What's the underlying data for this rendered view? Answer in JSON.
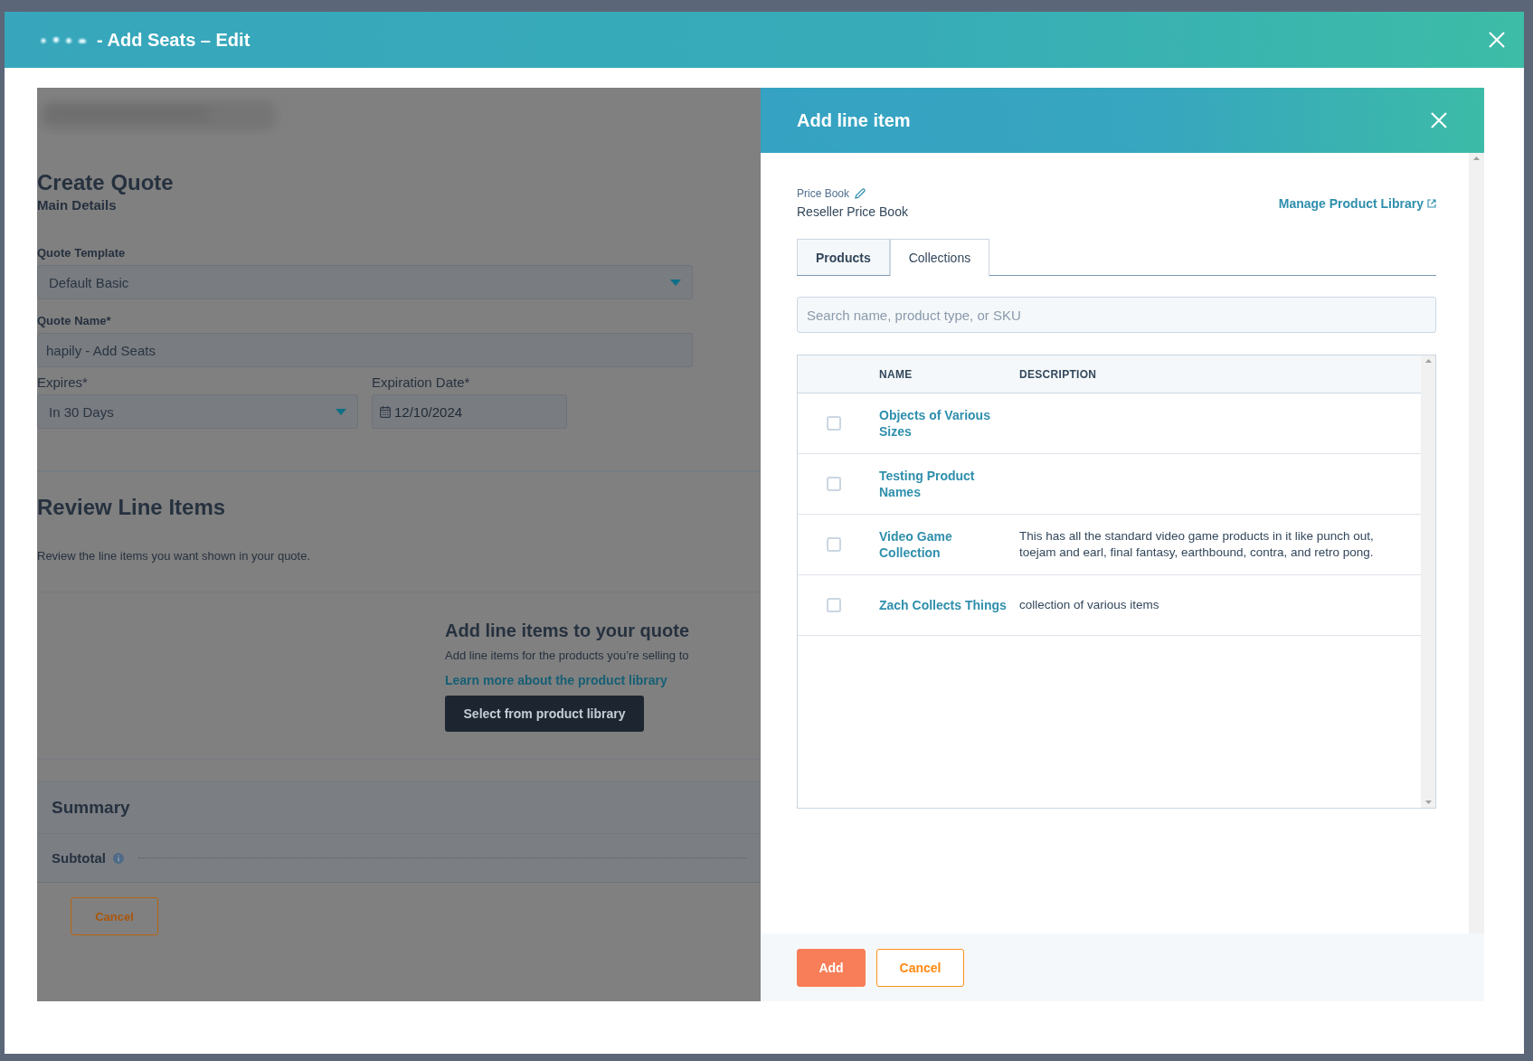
{
  "dialog": {
    "title": "- Add Seats – Edit"
  },
  "quote_form": {
    "heading": "Create Quote",
    "subheading": "Main Details",
    "fields": [
      {
        "kind": "select",
        "label": "Quote Template",
        "value": "Default Basic"
      },
      {
        "kind": "text",
        "label": "Quote Name*",
        "value": "hapily - Add Seats"
      },
      {
        "kind": "select",
        "label": "Expires*",
        "value": "In 30 Days"
      },
      {
        "kind": "date",
        "label": "Expiration Date*",
        "value": "12/10/2024"
      }
    ]
  },
  "line_items": {
    "heading": "Review Line Items",
    "description": "Review the line items you want shown in your quote.",
    "empty_heading": "Add line items to your quote",
    "empty_text": "Add line items for the products you’re selling to",
    "link": "Learn more about the product library",
    "button": "Select from product library"
  },
  "summary": {
    "heading": "Summary",
    "subtotal_label": "Subtotal"
  },
  "form_buttons": [
    "Cancel"
  ],
  "panel": {
    "title": "Add line item",
    "price_book_label": "Price Book",
    "price_book": "Reseller Price Book",
    "manage_link": "Manage Product Library",
    "tabs": [
      {
        "label": "Products",
        "selected": false
      },
      {
        "label": "Collections",
        "selected": true
      }
    ],
    "search": {
      "placeholder": "Search name, product type, or SKU"
    },
    "columns": [
      "NAME",
      "DESCRIPTION"
    ],
    "rows": [
      {
        "name": "Objects of Various Sizes",
        "checked": false
      },
      {
        "name": "Testing Product Names",
        "checked": false
      },
      {
        "name": "Video Game Collection",
        "description": "This has all the standard video game products in it like punch out, toejam and earl, final fantasy, earthbound, contra, and retro pong.",
        "checked": false
      },
      {
        "name": "Zach Collects Things",
        "description": "collection of various items",
        "checked": false
      }
    ],
    "buttons": [
      {
        "label": "Add",
        "kind": "primary"
      },
      {
        "label": "Cancel",
        "kind": "secondary"
      }
    ]
  }
}
